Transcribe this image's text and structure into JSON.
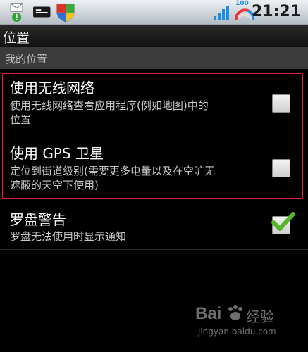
{
  "status": {
    "time": "21:21",
    "battery_level": "100",
    "icons": [
      "notification-alert-icon",
      "message-icon",
      "shield-icon",
      "signal-icon",
      "battery-gauge-icon"
    ]
  },
  "header": {
    "title": "位置"
  },
  "section": {
    "label": "我的位置"
  },
  "settings": [
    {
      "title": "使用无线网络",
      "summary_line1": "使用无线网络查看应用程序(例如地图)中的",
      "summary_line2": "位置",
      "checked": false
    },
    {
      "title": "使用 GPS 卫星",
      "summary_line1": "定位到街道级别(需要更多电量以及在空旷无",
      "summary_line2": "遮蔽的天空下使用)",
      "checked": false
    },
    {
      "title": "罗盘警告",
      "summary_line1": "罗盘无法使用时显示通知",
      "checked": true
    }
  ],
  "colors": {
    "highlight_border": "#e0202c",
    "check_green": "#55b62a"
  },
  "watermark": {
    "brand": "Bai",
    "brand2": "经验",
    "url": "jingyan.baidu.com"
  }
}
